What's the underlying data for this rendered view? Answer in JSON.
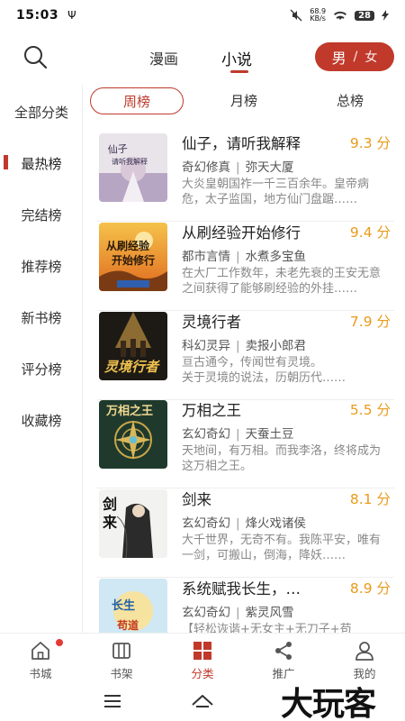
{
  "status": {
    "time": "15:03",
    "usb": "Ψ",
    "speed": "68.9\nKB/s",
    "battery": "28"
  },
  "topnav": {
    "tab_comic": "漫画",
    "tab_novel": "小说",
    "gender_male": "男",
    "gender_sep": "/",
    "gender_female": "女"
  },
  "sidebar": {
    "items": [
      {
        "label": "全部分类"
      },
      {
        "label": "最热榜"
      },
      {
        "label": "完结榜"
      },
      {
        "label": "推荐榜"
      },
      {
        "label": "新书榜"
      },
      {
        "label": "评分榜"
      },
      {
        "label": "收藏榜"
      }
    ],
    "active": 1
  },
  "rank_tabs": {
    "weekly": "周榜",
    "monthly": "月榜",
    "total": "总榜"
  },
  "books": [
    {
      "title": "仙子，请听我解释",
      "score": "9.3 分",
      "genre": "奇幻修真",
      "author": "弥天大厦",
      "desc": "大炎皇朝国祚一千三百余年。皇帝病危，太子监国，地方仙门盘踞……",
      "cover_text": "仙子请听我解释"
    },
    {
      "title": "从刷经验开始修行",
      "score": "9.4 分",
      "genre": "都市言情",
      "author": "水煮多宝鱼",
      "desc": "在大厂工作数年，未老先衰的王安无意之间获得了能够刷经验的外挂……",
      "cover_text": "从刷经验开始修行"
    },
    {
      "title": "灵境行者",
      "score": "7.9 分",
      "genre": "科幻灵异",
      "author": "卖报小郎君",
      "desc": "亘古通今，传闻世有灵境。\n    关于灵境的说法，历朝历代……",
      "cover_text": "灵境行者"
    },
    {
      "title": "万相之王",
      "score": "5.5 分",
      "genre": "玄幻奇幻",
      "author": "天蚕土豆",
      "desc": "天地间，有万相。而我李洛，终将成为这万相之王。",
      "cover_text": "万相之王"
    },
    {
      "title": "剑来",
      "score": "8.1 分",
      "genre": "玄幻奇幻",
      "author": "烽火戏诸侯",
      "desc": "大千世界，无奇不有。我陈平安，唯有一剑，可搬山，倒海，降妖……",
      "cover_text": "剑来"
    },
    {
      "title": "系统赋我长生，…",
      "score": "8.9 分",
      "genre": "玄幻奇幻",
      "author": "紫灵风雪",
      "desc": "【轻松诙谐+无女主+无刀子+苟",
      "cover_text": "长生"
    }
  ],
  "tabbar": [
    {
      "label": "书城",
      "icon": "home-icon"
    },
    {
      "label": "书架",
      "icon": "bookshelf-icon"
    },
    {
      "label": "分类",
      "icon": "category-icon"
    },
    {
      "label": "推广",
      "icon": "share-icon"
    },
    {
      "label": "我的",
      "icon": "profile-icon"
    }
  ],
  "watermark": "大玩客",
  "colors": {
    "accent": "#c0392b",
    "score": "#e89b1b"
  }
}
